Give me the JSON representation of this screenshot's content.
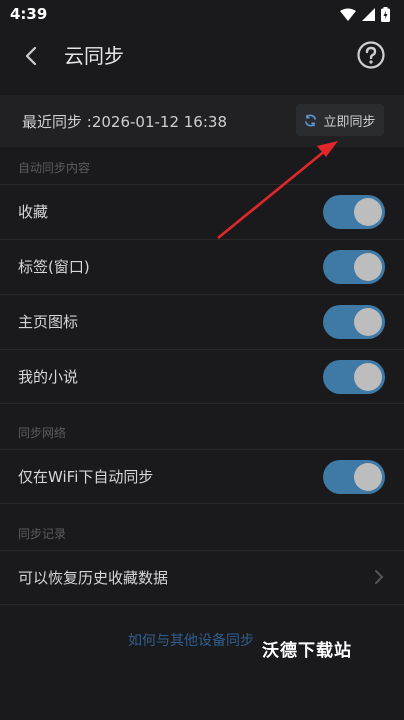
{
  "status": {
    "time": "4:39"
  },
  "header": {
    "title": "云同步"
  },
  "sync": {
    "last_sync": "最近同步 :2026-01-12 16:38",
    "button_label": "立即同步"
  },
  "sections": {
    "content": "自动同步内容",
    "network": "同步网络",
    "records": "同步记录"
  },
  "items": [
    {
      "label": "收藏",
      "on": true
    },
    {
      "label": "标签(窗口)",
      "on": true
    },
    {
      "label": "主页图标",
      "on": true
    },
    {
      "label": "我的小说",
      "on": true
    }
  ],
  "network_item": {
    "label": "仅在WiFi下自动同步",
    "on": true
  },
  "records_item": {
    "label": "可以恢复历史收藏数据"
  },
  "footer": {
    "help_link": "如何与其他设备同步",
    "watermark": "沃德下载站"
  },
  "colors": {
    "toggle_on": "#3f7aa6",
    "arrow": "#e0282c",
    "link": "#2f5f8e"
  }
}
